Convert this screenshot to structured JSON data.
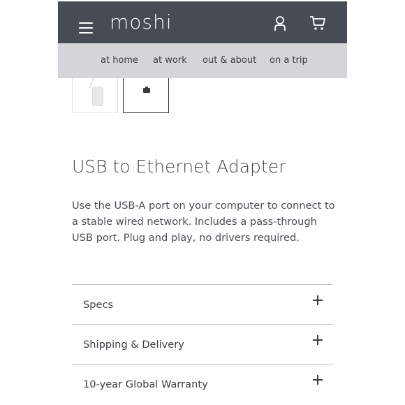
{
  "header": {
    "logo": "moshi",
    "menu_icon": "hamburger-menu-icon",
    "account_icon": "user-icon",
    "cart_icon": "cart-icon",
    "background": "#464b54"
  },
  "nav": {
    "items": [
      {
        "label": "at home"
      },
      {
        "label": "at work"
      },
      {
        "label": "out & about"
      },
      {
        "label": "on a trip"
      }
    ],
    "background": "#d5d6d9"
  },
  "gallery": {
    "thumbnails": [
      "usb-adapter-thumbnail",
      "ethernet-port-thumbnail"
    ],
    "selected_index": 1
  },
  "product": {
    "title": "USB to Ethernet Adapter",
    "description": "Use the USB-A port on your computer to connect to a stable wired network. Includes a pass-through USB port. Plug and play, no drivers required."
  },
  "accordion": {
    "sections": [
      {
        "label": "Specs",
        "icon": "plus-icon"
      },
      {
        "label": "Shipping & Delivery",
        "icon": "plus-icon"
      },
      {
        "label": "10-year Global Warranty",
        "icon": "plus-icon"
      }
    ]
  }
}
